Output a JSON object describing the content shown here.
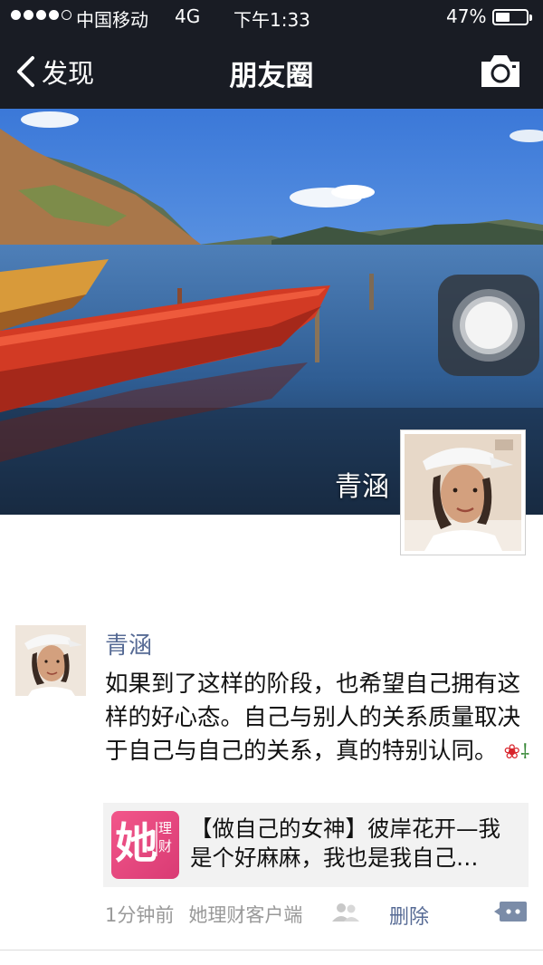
{
  "status_bar": {
    "carrier": "中国移动",
    "network": "4G",
    "time": "下午1:33",
    "battery_percent": "47%",
    "battery_level": 0.47,
    "signal_bars_filled": 4,
    "signal_bars_total": 5
  },
  "nav": {
    "back_label": "发现",
    "title": "朋友圈",
    "camera_icon": "camera-icon"
  },
  "cover": {
    "user_name": "青涵"
  },
  "post": {
    "author": "青涵",
    "text": "如果到了这样的阶段，也希望自己拥有这样的好心态。自己与别人的关系质量取决于自己与自己的关系，真的特别认同。",
    "emoji_icon": "rose-icon",
    "shared_link": {
      "icon_text_big": "她",
      "icon_text_small_1": "理",
      "icon_text_small_2": "财",
      "title": "【做自己的女神】彼岸花开—我是个好麻麻，我也是我自己…"
    },
    "time": "1分钟前",
    "source": "她理财客户端",
    "delete_label": "删除"
  },
  "colors": {
    "nav_bg": "#191c24",
    "link_blue": "#576b95",
    "share_bg": "#f2f2f2",
    "meta_gray": "#999999",
    "brand_pink": "#e64a80"
  }
}
